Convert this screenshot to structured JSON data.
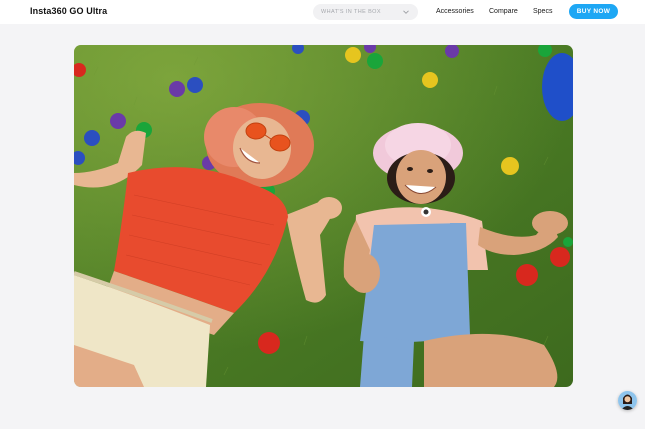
{
  "header": {
    "brand": "Insta360 GO Ultra",
    "dropdown_label": "WHAT'S IN THE BOX",
    "nav": {
      "accessories": "Accessories",
      "compare": "Compare",
      "specs": "Specs"
    },
    "buy_label": "BUY NOW"
  },
  "colors": {
    "accent": "#1ea7f4",
    "background": "#f4f4f6"
  },
  "icons": {
    "dropdown": "chevron-down-icon",
    "chat": "chat-avatar-icon"
  }
}
